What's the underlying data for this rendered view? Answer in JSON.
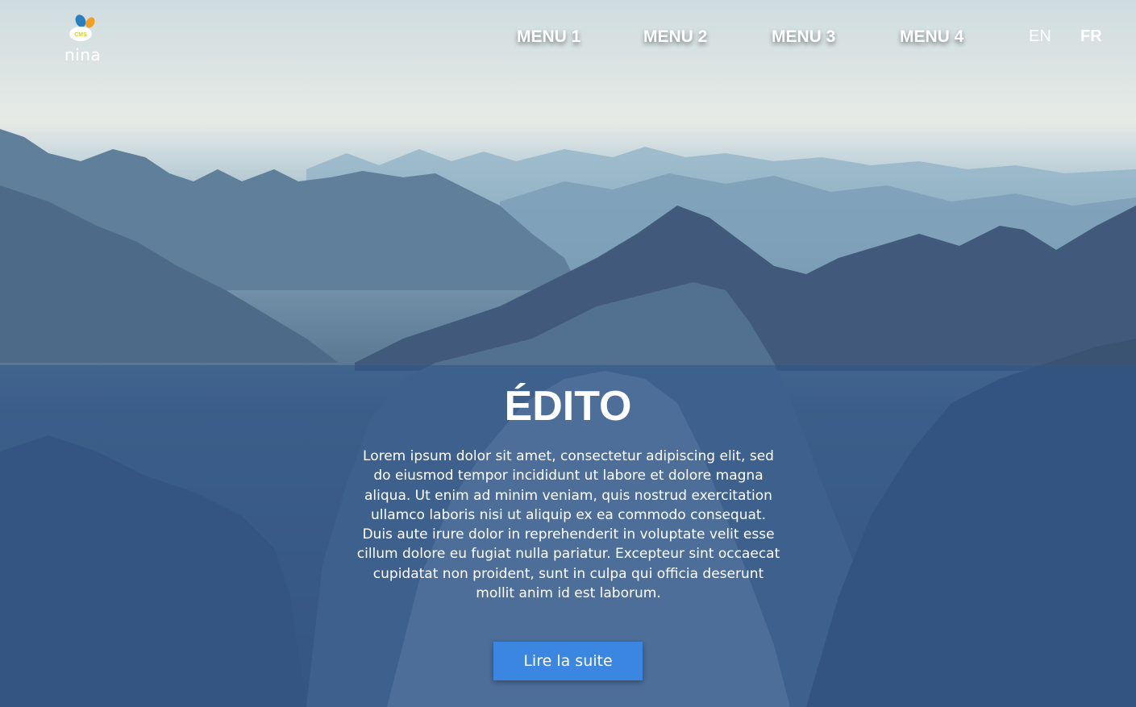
{
  "header": {
    "logo_text": "nina",
    "logo_badge": "CMS",
    "nav": [
      {
        "label": "MENU 1"
      },
      {
        "label": "MENU 2"
      },
      {
        "label": "MENU 3"
      },
      {
        "label": "MENU 4"
      }
    ],
    "languages": [
      {
        "label": "EN",
        "active": false
      },
      {
        "label": "FR",
        "active": true
      }
    ]
  },
  "edito": {
    "title": "ÉDITO",
    "body": "Lorem ipsum dolor sit amet, consectetur adipiscing elit, sed do eiusmod tempor incididunt ut labore et dolore magna aliqua. Ut enim ad minim veniam, quis nostrud exercitation ullamco laboris nisi ut aliquip ex ea commodo consequat. Duis aute irure dolor in reprehenderit in voluptate velit esse cillum dolore eu fugiat nulla pariatur. Excepteur sint occaecat cupidatat non proident, sunt in culpa qui officia deserunt mollit anim id est laborum.",
    "cta_label": "Lire la suite"
  },
  "colors": {
    "accent": "#3b86e0",
    "panel_overlay": "#2e548c",
    "logo_blue": "#2a7fc1",
    "logo_orange": "#f0a020",
    "logo_green": "#c8d23a"
  },
  "icons": [
    "nina-cms-logo",
    "mountain-background-image"
  ]
}
